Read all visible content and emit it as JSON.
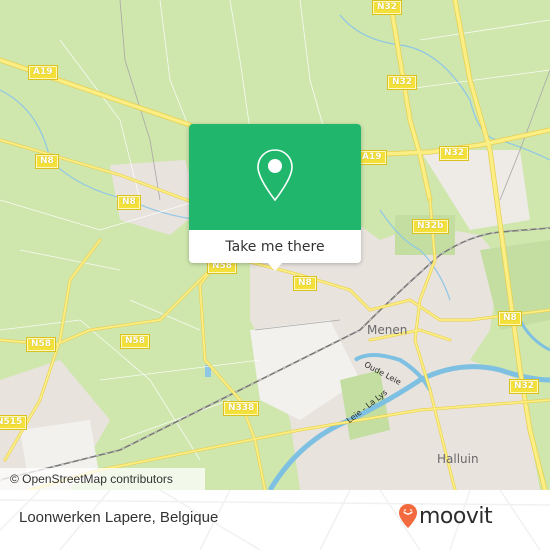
{
  "map": {
    "road_labels": [
      {
        "id": "a19-west",
        "text": "A19"
      },
      {
        "id": "n8-west",
        "text": "N8"
      },
      {
        "id": "n8-west2",
        "text": "N8"
      },
      {
        "id": "n32-top",
        "text": "N32"
      },
      {
        "id": "n32-mid",
        "text": "N32"
      },
      {
        "id": "a19-east",
        "text": "A19"
      },
      {
        "id": "n32-east",
        "text": "N32"
      },
      {
        "id": "n32b",
        "text": "N32b"
      },
      {
        "id": "n58-center",
        "text": "N58"
      },
      {
        "id": "n8-center",
        "text": "N8"
      },
      {
        "id": "n58-west",
        "text": "N58"
      },
      {
        "id": "n58-mid",
        "text": "N58"
      },
      {
        "id": "n8-east",
        "text": "N8"
      },
      {
        "id": "n338",
        "text": "N338"
      },
      {
        "id": "n515",
        "text": "N515"
      },
      {
        "id": "n32-south",
        "text": "N32"
      }
    ],
    "places": [
      {
        "id": "menen",
        "text": "Menen"
      },
      {
        "id": "halluin",
        "text": "Halluin"
      }
    ],
    "water_labels": [
      {
        "id": "oude-leie",
        "text": "Oude Leie"
      },
      {
        "id": "leie-la-lys",
        "text": "Leie - La Lys"
      }
    ],
    "attribution": "© OpenStreetMap contributors"
  },
  "popup": {
    "icon": "location-pin-icon",
    "button_label": "Take me there",
    "accent_color": "#20b76c"
  },
  "footer": {
    "place_name": "Loonwerken Lapere, Belgique",
    "brand": "moovit",
    "brand_color": "#f26a3d"
  }
}
